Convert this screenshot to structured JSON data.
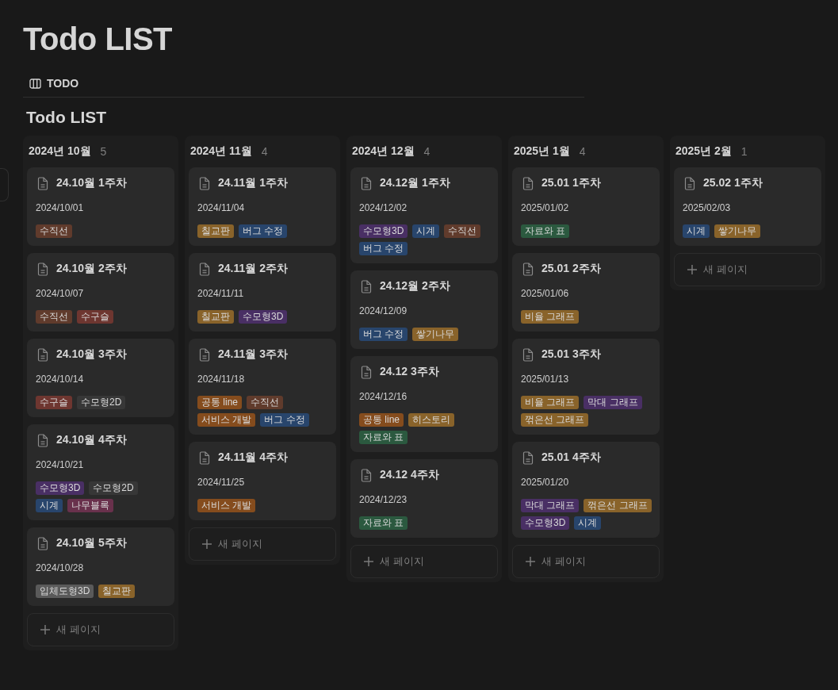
{
  "page_title": "Todo LIST",
  "view_tab": {
    "label": "TODO",
    "selected": true
  },
  "board_title": "Todo LIST",
  "columns": [
    {
      "title": "2024년 10월",
      "count": "5",
      "new_page_label": "새 페이지",
      "cards": [
        {
          "title": "24.10월 1주차",
          "date": "2024/10/01",
          "tags": [
            {
              "label": "수직선",
              "color": "#603b2c"
            }
          ]
        },
        {
          "title": "24.10월 2주차",
          "date": "2024/10/07",
          "tags": [
            {
              "label": "수직선",
              "color": "#603b2c"
            },
            {
              "label": "수구슬",
              "color": "#6e3630"
            }
          ]
        },
        {
          "title": "24.10월 3주차",
          "date": "2024/10/14",
          "tags": [
            {
              "label": "수구슬",
              "color": "#6e3630"
            },
            {
              "label": "수모형2D",
              "color": "#373737"
            }
          ]
        },
        {
          "title": "24.10월 4주차",
          "date": "2024/10/21",
          "tags": [
            {
              "label": "수모형3D",
              "color": "#492f64"
            },
            {
              "label": "수모형2D",
              "color": "#373737"
            },
            {
              "label": "시계",
              "color": "#28456c"
            },
            {
              "label": "나무블록",
              "color": "#69314c"
            }
          ]
        },
        {
          "title": "24.10월 5주차",
          "date": "2024/10/28",
          "tags": [
            {
              "label": "입체도형3D",
              "color": "#5a5a5a"
            },
            {
              "label": "칠교판",
              "color": "#89632a"
            }
          ]
        }
      ]
    },
    {
      "title": "2024년 11월",
      "count": "4",
      "new_page_label": "새 페이지",
      "cards": [
        {
          "title": "24.11월 1주차",
          "date": "2024/11/04",
          "tags": [
            {
              "label": "칠교판",
              "color": "#89632a"
            },
            {
              "label": "버그 수정",
              "color": "#28456c"
            }
          ]
        },
        {
          "title": "24.11월 2주차",
          "date": "2024/11/11",
          "tags": [
            {
              "label": "칠교판",
              "color": "#89632a"
            },
            {
              "label": "수모형3D",
              "color": "#492f64"
            }
          ]
        },
        {
          "title": "24.11월 3주차",
          "date": "2024/11/18",
          "tags": [
            {
              "label": "공통 line",
              "color": "#854c1d"
            },
            {
              "label": "수직선",
              "color": "#603b2c"
            },
            {
              "label": "서비스 개발",
              "color": "#854c1d"
            },
            {
              "label": "버그 수정",
              "color": "#28456c"
            }
          ]
        },
        {
          "title": "24.11월 4주차",
          "date": "2024/11/25",
          "tags": [
            {
              "label": "서비스 개발",
              "color": "#854c1d"
            }
          ]
        }
      ]
    },
    {
      "title": "2024년 12월",
      "count": "4",
      "new_page_label": "새 페이지",
      "cards": [
        {
          "title": "24.12월 1주차",
          "date": "2024/12/02",
          "tags": [
            {
              "label": "수모형3D",
              "color": "#492f64"
            },
            {
              "label": "시계",
              "color": "#28456c"
            },
            {
              "label": "수직선",
              "color": "#603b2c"
            },
            {
              "label": "버그 수정",
              "color": "#28456c"
            }
          ]
        },
        {
          "title": "24.12월 2주차",
          "date": "2024/12/09",
          "tags": [
            {
              "label": "버그 수정",
              "color": "#28456c"
            },
            {
              "label": "쌓기나무",
              "color": "#89632a"
            }
          ]
        },
        {
          "title": "24.12 3주차",
          "date": "2024/12/16",
          "tags": [
            {
              "label": "공통 line",
              "color": "#854c1d"
            },
            {
              "label": "히스토리",
              "color": "#89632a"
            },
            {
              "label": "자료와 표",
              "color": "#2b593f"
            }
          ]
        },
        {
          "title": "24.12 4주차",
          "date": "2024/12/23",
          "tags": [
            {
              "label": "자료와 표",
              "color": "#2b593f"
            }
          ]
        }
      ]
    },
    {
      "title": "2025년 1월",
      "count": "4",
      "new_page_label": "새 페이지",
      "cards": [
        {
          "title": "25.01 1주차",
          "date": "2025/01/02",
          "tags": [
            {
              "label": "자료와 표",
              "color": "#2b593f"
            }
          ]
        },
        {
          "title": "25.01 2주차",
          "date": "2025/01/06",
          "tags": [
            {
              "label": "비율 그래프",
              "color": "#89632a"
            }
          ]
        },
        {
          "title": "25.01 3주차",
          "date": "2025/01/13",
          "tags": [
            {
              "label": "비율 그래프",
              "color": "#89632a"
            },
            {
              "label": "막대 그래프",
              "color": "#492f64"
            },
            {
              "label": "꺾은선 그래프",
              "color": "#89632a"
            }
          ]
        },
        {
          "title": "25.01 4주차",
          "date": "2025/01/20",
          "tags": [
            {
              "label": "막대 그래프",
              "color": "#492f64"
            },
            {
              "label": "꺾은선 그래프",
              "color": "#89632a"
            },
            {
              "label": "수모형3D",
              "color": "#492f64"
            },
            {
              "label": "시계",
              "color": "#28456c"
            }
          ]
        }
      ]
    },
    {
      "title": "2025년 2월",
      "count": "1",
      "new_page_label": "새 페이지",
      "cards": [
        {
          "title": "25.02 1주차",
          "date": "2025/02/03",
          "tags": [
            {
              "label": "시계",
              "color": "#28456c"
            },
            {
              "label": "쌓기나무",
              "color": "#89632a"
            }
          ]
        }
      ]
    }
  ]
}
